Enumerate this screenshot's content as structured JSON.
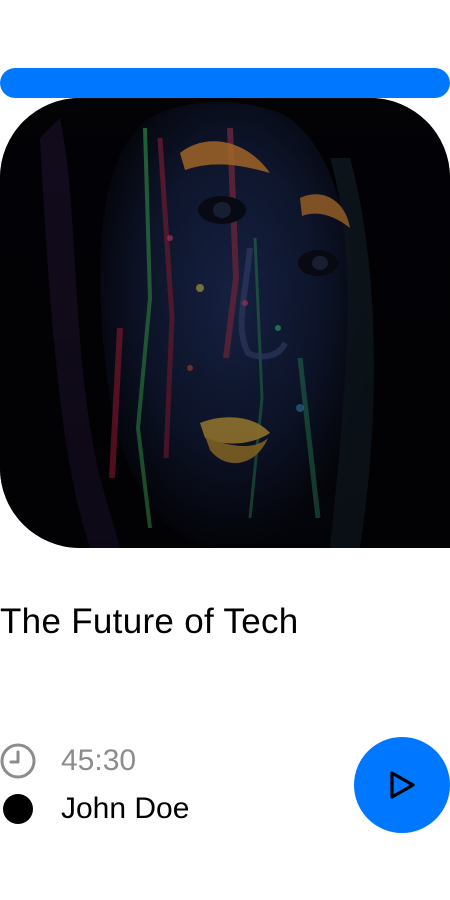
{
  "colors": {
    "accent": "#0077ff",
    "title": "#000000",
    "muted": "#8c8c8c"
  },
  "player": {
    "progress": 1.0
  },
  "episode": {
    "title": "The Future of Tech",
    "duration": "45:30",
    "author": "John Doe"
  },
  "icons": {
    "duration": "clock-icon",
    "author": "avatar-dot",
    "play": "play-icon"
  }
}
